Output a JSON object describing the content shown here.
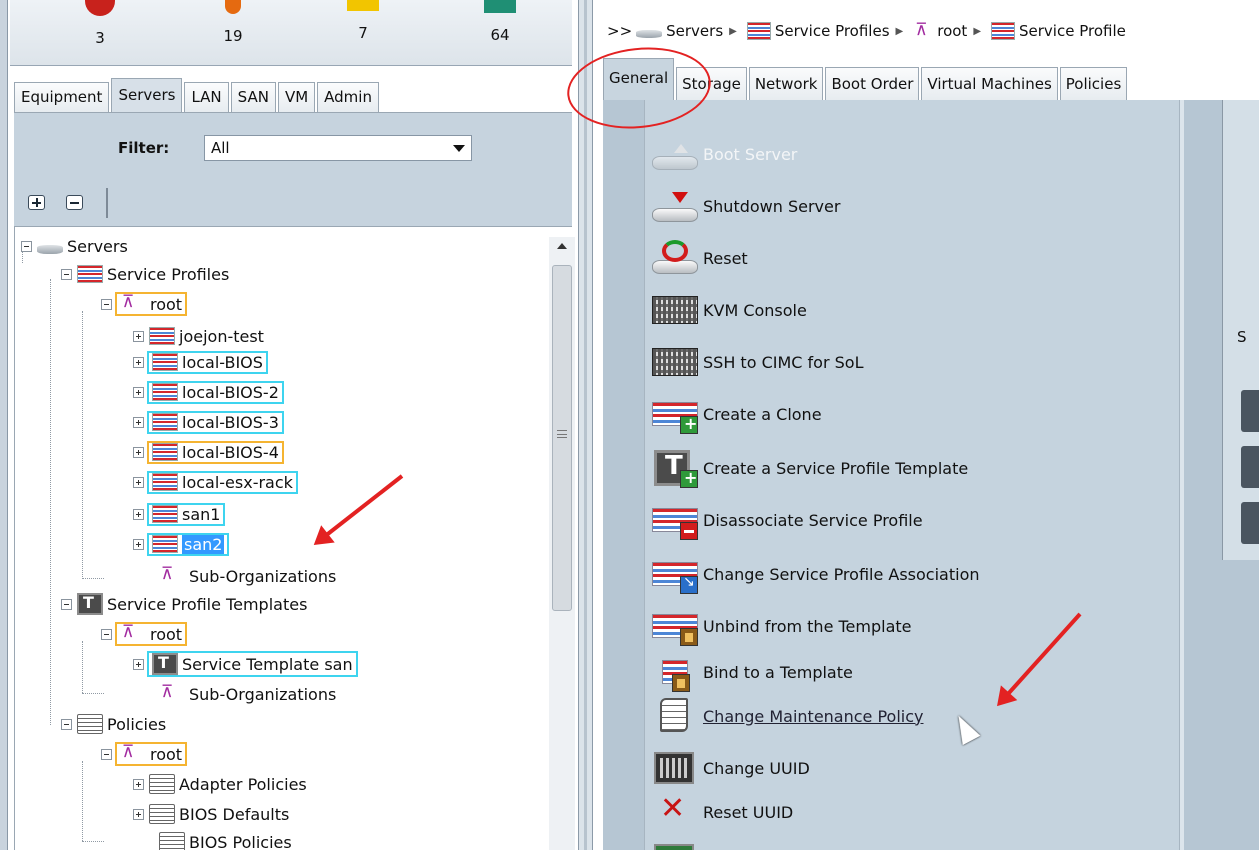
{
  "fault_summary": [
    {
      "level": "critical",
      "icon": "critical-fault-icon",
      "count": "3",
      "color": "#c8221c"
    },
    {
      "level": "major",
      "icon": "major-fault-icon",
      "count": "19",
      "color": "#e56a10"
    },
    {
      "level": "minor",
      "icon": "minor-fault-icon",
      "count": "7",
      "color": "#f2c500"
    },
    {
      "level": "warning",
      "icon": "warning-fault-icon",
      "count": "64",
      "color": "#1f8f74"
    }
  ],
  "nav_tabs": [
    "Equipment",
    "Servers",
    "LAN",
    "SAN",
    "VM",
    "Admin"
  ],
  "active_nav_tab": "Servers",
  "filter": {
    "label": "Filter:",
    "value": "All"
  },
  "tree": {
    "servers": "Servers",
    "service_profiles": "Service Profiles",
    "root": "root",
    "profiles": [
      "joejon-test",
      "local-BIOS",
      "local-BIOS-2",
      "local-BIOS-3",
      "local-BIOS-4",
      "local-esx-rack",
      "san1",
      "san2"
    ],
    "sub_orgs": "Sub-Organizations",
    "service_profile_templates": "Service Profile Templates",
    "template_root": "root",
    "template": "Service Template san",
    "template_sub_orgs": "Sub-Organizations",
    "policies": "Policies",
    "policies_root": "root",
    "policy_items": [
      "Adapter Policies",
      "BIOS Defaults",
      "BIOS Policies"
    ]
  },
  "breadcrumb": {
    "chevrons": ">>",
    "items": [
      "Servers",
      "Service Profiles",
      "root",
      "Service Profile"
    ]
  },
  "content_tabs": [
    "General",
    "Storage",
    "Network",
    "Boot Order",
    "Virtual Machines",
    "Policies"
  ],
  "active_content_tab": "General",
  "actions": [
    {
      "label": "Boot Server",
      "icon": "boot-server-icon",
      "state": "disabled"
    },
    {
      "label": "Shutdown Server",
      "icon": "shutdown-server-icon",
      "state": "enabled"
    },
    {
      "label": "Reset",
      "icon": "reset-icon",
      "state": "enabled"
    },
    {
      "label": "KVM Console",
      "icon": "keyboard-icon",
      "state": "enabled"
    },
    {
      "label": "SSH to CIMC for SoL",
      "icon": "keyboard-icon",
      "state": "enabled"
    },
    {
      "label": "Create a Clone",
      "icon": "clone-icon",
      "state": "enabled"
    },
    {
      "label": "Create a Service Profile Template",
      "icon": "template-icon",
      "state": "enabled"
    },
    {
      "label": "Disassociate Service Profile",
      "icon": "disassociate-icon",
      "state": "enabled"
    },
    {
      "label": "Change Service Profile Association",
      "icon": "association-icon",
      "state": "enabled"
    },
    {
      "label": "Unbind from the Template",
      "icon": "unbind-icon",
      "state": "enabled"
    },
    {
      "label": "Bind to a Template",
      "icon": "bind-icon",
      "state": "enabled"
    },
    {
      "label": "Change Maintenance Policy",
      "icon": "maintenance-policy-icon",
      "state": "hover"
    },
    {
      "label": "Change UUID",
      "icon": "uuid-icon",
      "state": "enabled"
    },
    {
      "label": "Reset UUID",
      "icon": "reset-uuid-icon",
      "state": "enabled"
    }
  ],
  "side_panel_letter": "S",
  "annotation_color": "#e32222"
}
